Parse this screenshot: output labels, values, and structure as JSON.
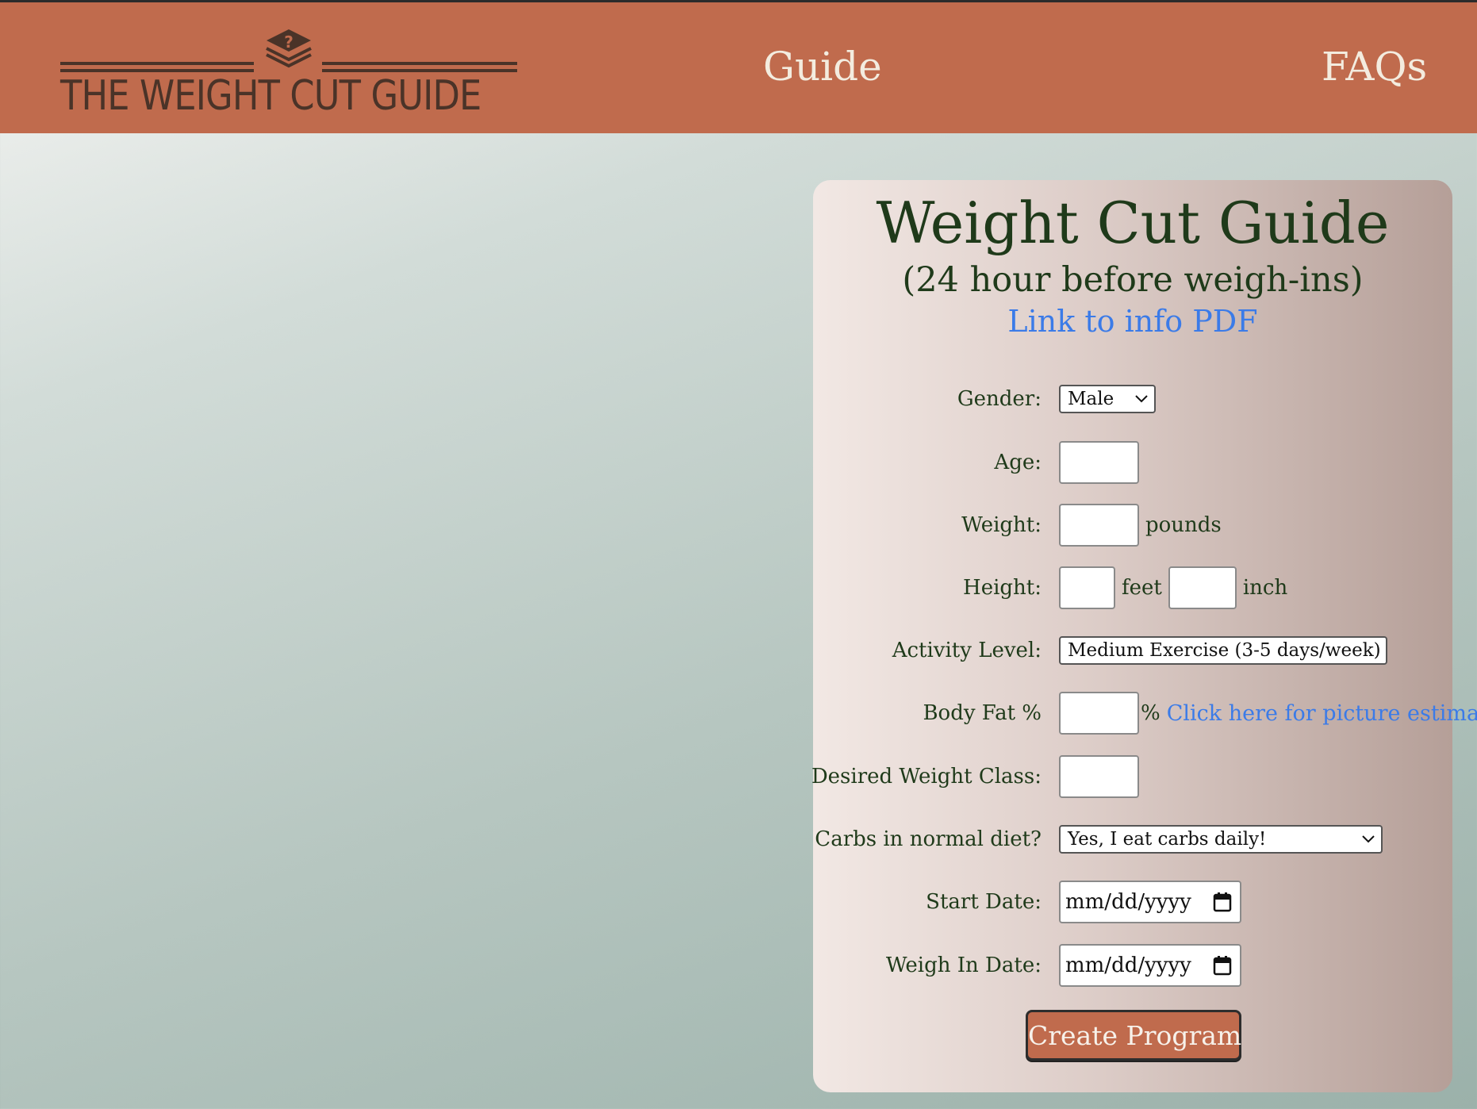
{
  "header": {
    "logo_text": "THE WEIGHT CUT GUIDE",
    "nav": {
      "guide": "Guide",
      "faqs": "FAQs"
    }
  },
  "form": {
    "title": "Weight Cut Guide",
    "subtitle": "(24 hour before weigh-ins)",
    "pdf_link": "Link to info PDF",
    "gender": {
      "label": "Gender:",
      "value": "Male"
    },
    "age": {
      "label": "Age:",
      "value": ""
    },
    "weight": {
      "label": "Weight:",
      "unit": "pounds",
      "value": ""
    },
    "height": {
      "label": "Height:",
      "feet_unit": "feet",
      "inch_unit": "inch"
    },
    "activity": {
      "label": "Activity Level:",
      "value": "Medium Exercise (3-5 days/week)"
    },
    "body_fat": {
      "label": "Body Fat %",
      "unit": "%",
      "link": "Click here for picture estimate"
    },
    "weight_class": {
      "label": "Desired Weight Class:"
    },
    "carbs": {
      "label": "Carbs in normal diet?",
      "value": "Yes, I eat carbs daily!"
    },
    "start_date": {
      "label": "Start Date:",
      "placeholder": "mm/dd/yyyy"
    },
    "weigh_in_date": {
      "label": "Weigh In Date:",
      "placeholder": "mm/dd/yyyy"
    },
    "submit": "Create Program"
  },
  "colors": {
    "header": "#c06b4d",
    "link": "#3b7be8",
    "text": "#1f3a1a",
    "button": "#c06b4d"
  }
}
